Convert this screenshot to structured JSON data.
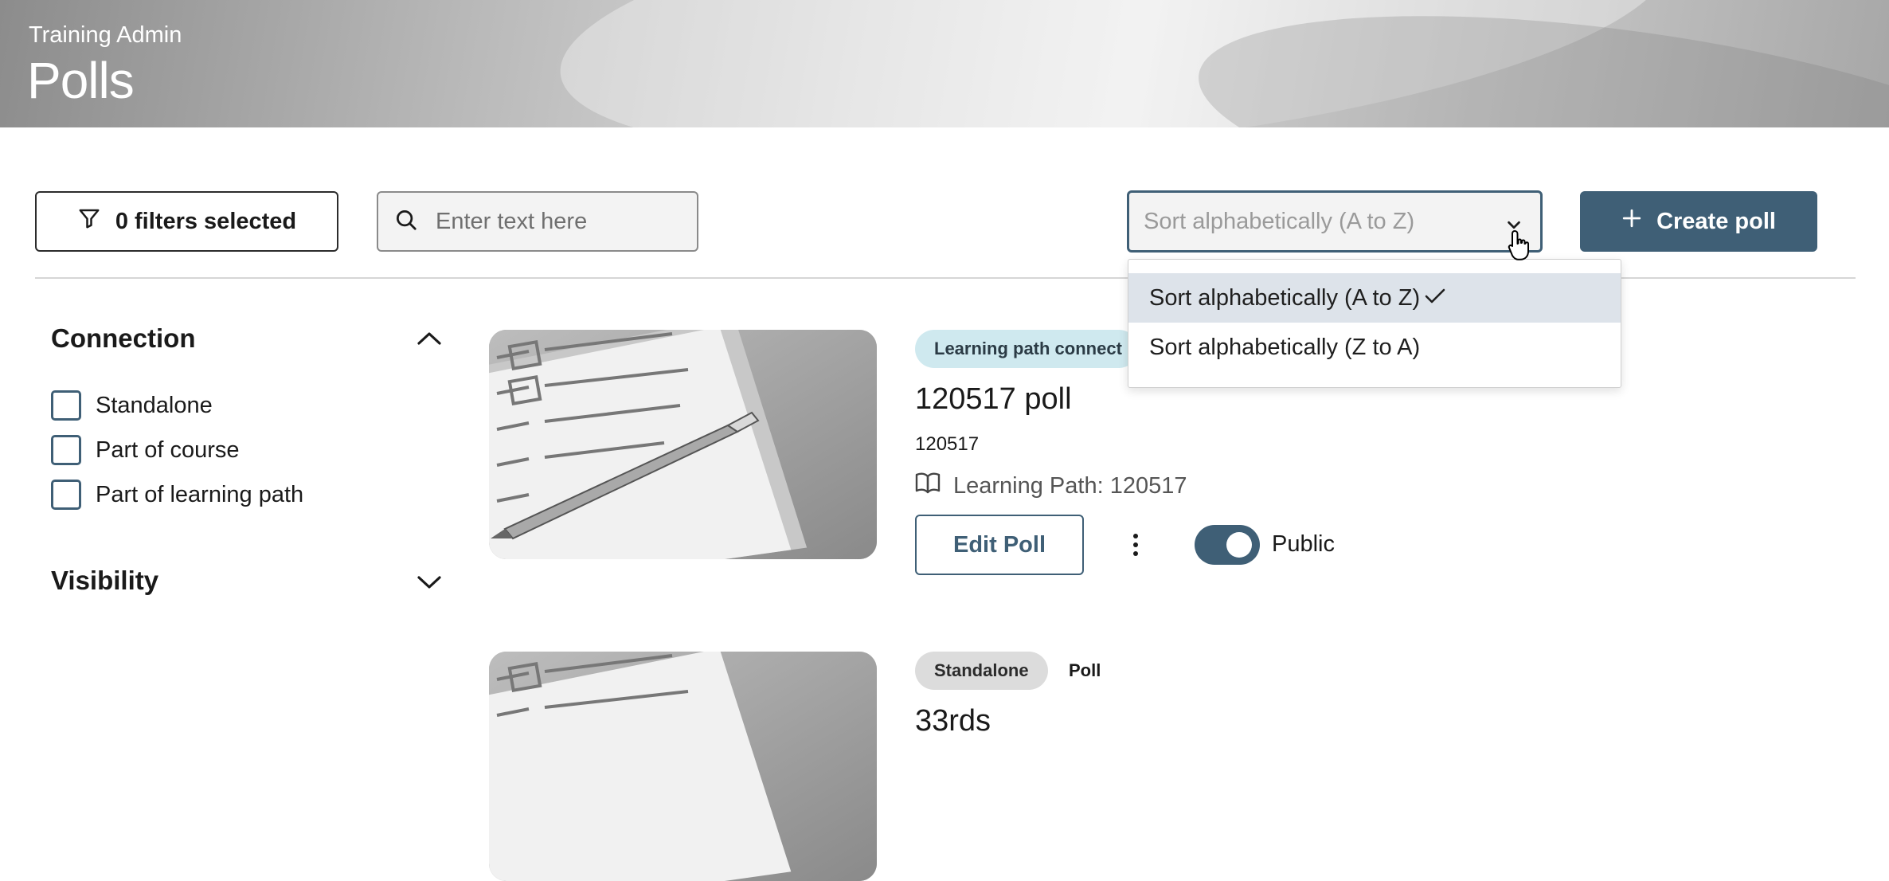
{
  "header": {
    "subtitle": "Training Admin",
    "title": "Polls"
  },
  "toolbar": {
    "filters_label": "0 filters selected",
    "search_placeholder": "Enter text here",
    "sort_value": "Sort alphabetically (A to Z)",
    "create_label": "Create poll"
  },
  "sort_menu": {
    "options": [
      {
        "label": "Sort alphabetically (A to Z)",
        "selected": true
      },
      {
        "label": "Sort alphabetically (Z to A)",
        "selected": false
      }
    ]
  },
  "sidebar": {
    "connection": {
      "heading": "Connection",
      "expanded": true,
      "options": [
        "Standalone",
        "Part of course",
        "Part of learning path"
      ]
    },
    "visibility": {
      "heading": "Visibility",
      "expanded": false
    }
  },
  "cards": [
    {
      "badge": "Learning path connect",
      "title": "120517 poll",
      "id": "120517",
      "path": "Learning Path: 120517",
      "edit_label": "Edit Poll",
      "visibility_label": "Public",
      "public": true
    },
    {
      "badge": "Standalone",
      "type": "Poll",
      "title": "33rds"
    }
  ],
  "colors": {
    "accent": "#3f5f76",
    "selected_row": "#dde3ea",
    "badge_blue": "#cfe9ef",
    "badge_grey": "#dcdcdc"
  }
}
